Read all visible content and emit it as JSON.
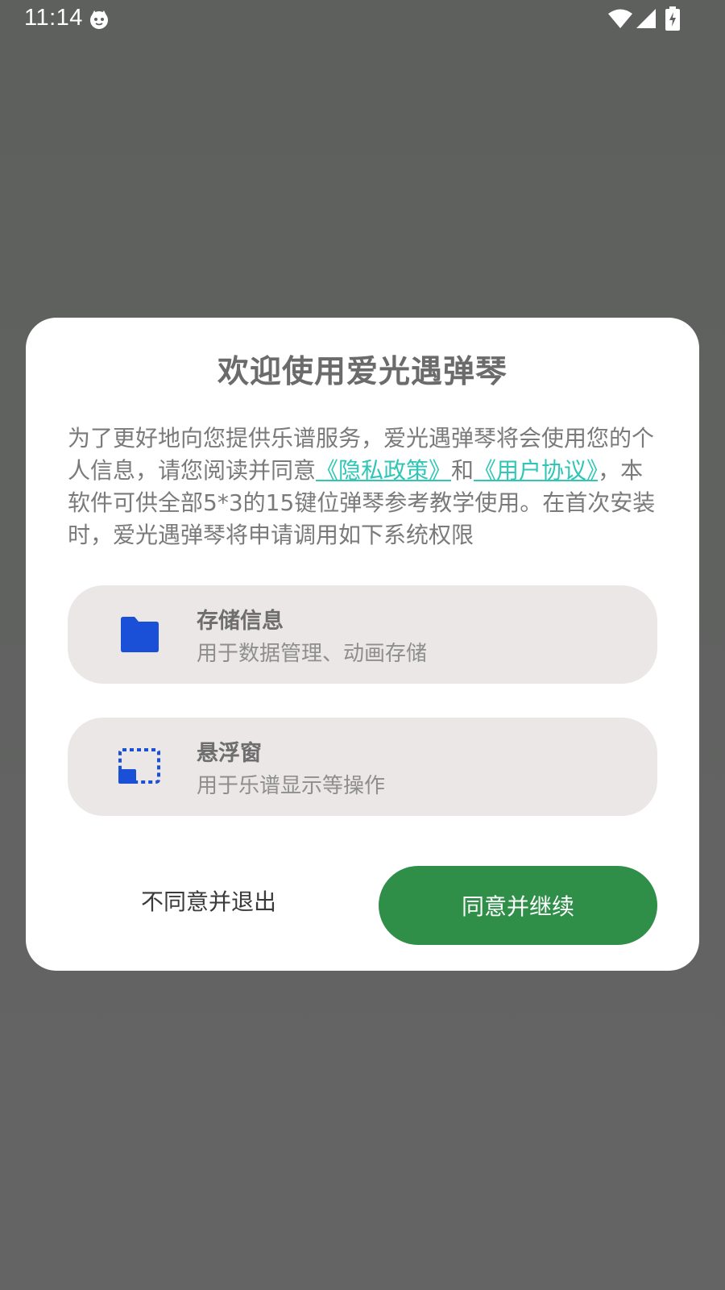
{
  "status_bar": {
    "time": "11:14",
    "icons": [
      "cat-face-notification-icon",
      "wifi-icon",
      "cellular-signal-icon",
      "battery-charging-icon"
    ]
  },
  "dialog": {
    "title": "欢迎使用爱光遇弹琴",
    "body": {
      "part1": "为了更好地向您提供乐谱服务，爱光遇弹琴将会使用您的个人信息，请您阅读并同意",
      "privacy_link": "《隐私政策》",
      "conjunction": "和",
      "agreement_link": "《用户协议》",
      "part2": "，本软件可供全部5*3的15键位弹琴参考教学使用。在首次安装时，爱光遇弹琴将申请调用如下系统权限"
    },
    "permissions": [
      {
        "name": "存储信息",
        "desc": "用于数据管理、动画存储",
        "icon": "folder-icon"
      },
      {
        "name": "悬浮窗",
        "desc": "用于乐谱显示等操作",
        "icon": "picture-in-picture-icon"
      }
    ],
    "buttons": {
      "decline": "不同意并退出",
      "accept": "同意并继续"
    }
  },
  "colors": {
    "backdrop": "#616361",
    "dialog_bg": "#ffffff",
    "title_text": "#6b6b6b",
    "body_text": "#7a7a7a",
    "link": "#2fc6b6",
    "card_bg": "#ebe7e7",
    "icon_blue": "#1a4fd8",
    "accept_button": "#2f8f48"
  }
}
